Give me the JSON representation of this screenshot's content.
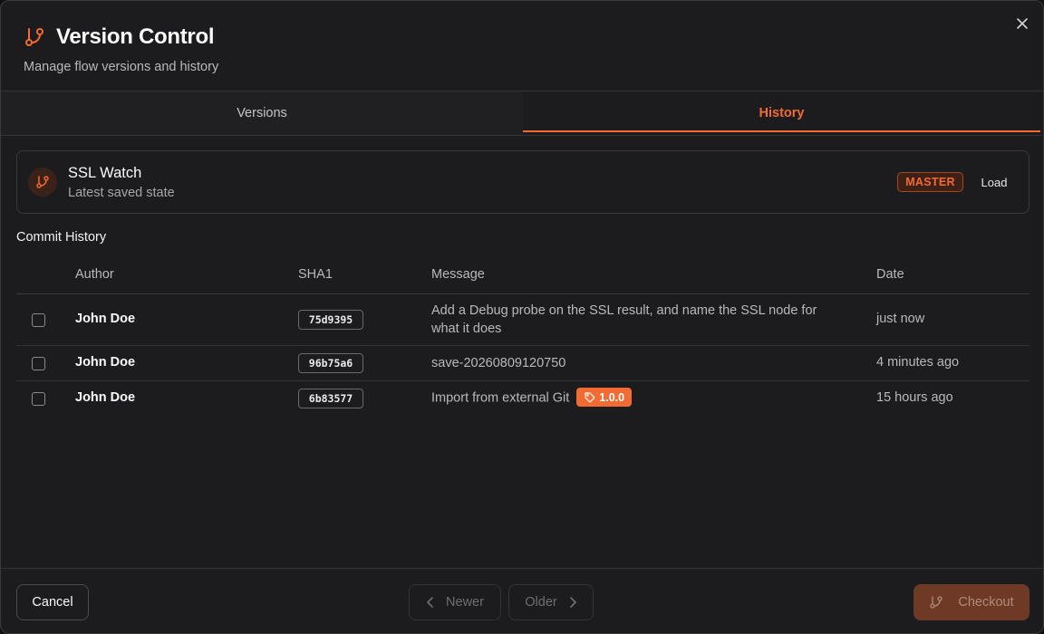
{
  "dialog": {
    "title": "Version Control",
    "subtitle": "Manage flow versions and history",
    "close_icon": "close-icon"
  },
  "tabs": [
    {
      "label": "Versions",
      "active": false
    },
    {
      "label": "History",
      "active": true
    }
  ],
  "flow": {
    "name": "SSL Watch",
    "description": "Latest saved state",
    "branch_badge": "MASTER",
    "load_label": "Load",
    "icon": "git-branch-icon"
  },
  "commit_history": {
    "title": "Commit History",
    "columns": [
      "Author",
      "SHA1",
      "Message",
      "Date"
    ],
    "rows": [
      {
        "author": "John Doe",
        "sha": "75d9395",
        "message_line1": "Add a Debug probe on the SSL result, and name the SSL node for",
        "message_line2": "what it does",
        "tag": "",
        "date": "just now",
        "checked": false
      },
      {
        "author": "John Doe",
        "sha": "96b75a6",
        "message_line1": "save-20260809120750",
        "message_line2": "",
        "tag": "",
        "date": "4 minutes ago",
        "checked": false
      },
      {
        "author": "John Doe",
        "sha": "6b83577",
        "message_line1": "Import from external Git",
        "message_line2": "",
        "tag": "1.0.0",
        "date": "15 hours ago",
        "checked": false
      }
    ]
  },
  "footer": {
    "cancel_label": "Cancel",
    "newer_label": "Newer",
    "older_label": "Older",
    "checkout_label": "Checkout"
  },
  "colors": {
    "accent": "#f26b32",
    "background": "#1c1c1e",
    "border": "#3a3a3d",
    "muted_text": "#b9b9bd"
  }
}
